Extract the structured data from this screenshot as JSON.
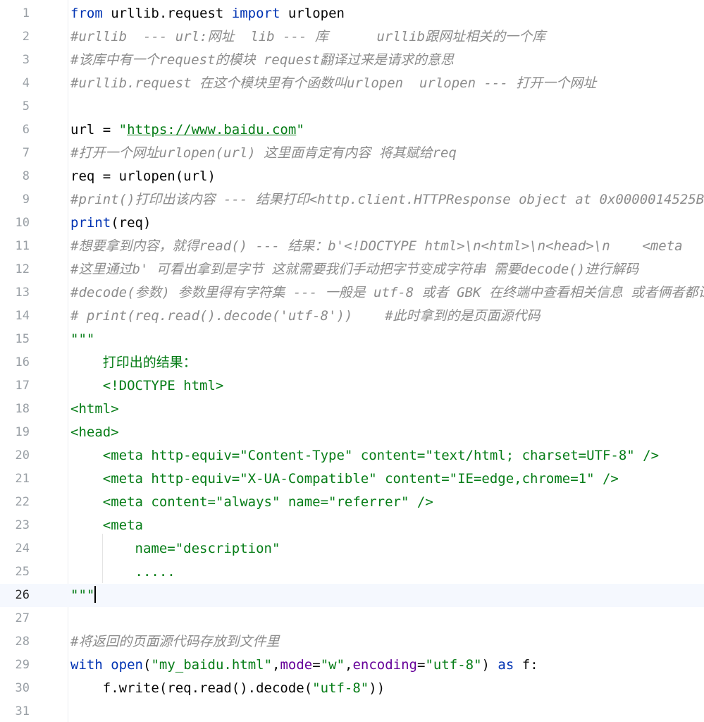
{
  "editor": {
    "line_numbers": [
      "1",
      "2",
      "3",
      "4",
      "5",
      "6",
      "7",
      "8",
      "9",
      "10",
      "11",
      "12",
      "13",
      "14",
      "15",
      "16",
      "17",
      "18",
      "19",
      "20",
      "21",
      "22",
      "23",
      "24",
      "25",
      "26",
      "27",
      "28",
      "29",
      "30",
      "31"
    ],
    "current_line": "26",
    "lines": {
      "l1": {
        "from": "from",
        "module": " urllib.request ",
        "import": "import",
        "name": " urlopen"
      },
      "l2": {
        "comment": "#urllib  --- url:网址  lib --- 库      urllib跟网址相关的一个库"
      },
      "l3": {
        "comment": "#该库中有一个request的模块 request翻译过来是请求的意思"
      },
      "l4": {
        "comment": "#urllib.request 在这个模块里有个函数叫urlopen  urlopen --- 打开一个网址"
      },
      "l6": {
        "lhs": "url = ",
        "q1": "\"",
        "url": "https://www.baidu.com",
        "q2": "\""
      },
      "l7": {
        "comment": "#打开一个网址urlopen(url) 这里面肯定有内容 将其赋给req"
      },
      "l8": {
        "code": "req = urlopen(url)"
      },
      "l9": {
        "comment": "#print()打印出该内容 --- 结果打印<http.client.HTTPResponse object at 0x0000014525B"
      },
      "l10": {
        "fn": "print",
        "rest": "(req)"
      },
      "l11": {
        "comment": "#想要拿到内容，就得read() --- 结果：b'<!DOCTYPE html>\\n<html>\\n<head>\\n    <meta"
      },
      "l12": {
        "comment": "#这里通过b' 可看出拿到是字节 这就需要我们手动把字节变成字符串 需要decode()进行解码"
      },
      "l13": {
        "comment": "#decode(参数) 参数里得有字符集 --- 一般是 utf-8 或者 GBK 在终端中查看相关信息 或者俩者都试"
      },
      "l14": {
        "comment": "# print(req.read().decode('utf-8'))    #此时拿到的是页面源代码"
      },
      "l15": {
        "str": "\"\"\""
      },
      "l16": {
        "str": "    打印出的结果："
      },
      "l17": {
        "str": "    <!DOCTYPE html>"
      },
      "l18": {
        "str": "<html>"
      },
      "l19": {
        "str": "<head>"
      },
      "l20": {
        "str": "    <meta http-equiv=\"Content-Type\" content=\"text/html; charset=UTF-8\" />"
      },
      "l21": {
        "str": "    <meta http-equiv=\"X-UA-Compatible\" content=\"IE=edge,chrome=1\" />"
      },
      "l22": {
        "str": "    <meta content=\"always\" name=\"referrer\" />"
      },
      "l23": {
        "str": "    <meta"
      },
      "l24": {
        "str": "        name=\"description\""
      },
      "l25": {
        "str": "        ....."
      },
      "l26": {
        "str": "\"\"\""
      },
      "l28": {
        "comment": "#将返回的页面源代码存放到文件里"
      },
      "l29": {
        "with": "with",
        "sp": " ",
        "open": "open",
        "p1": "(",
        "s1": "\"my_baidu.html\"",
        "c1": ",",
        "mode": "mode",
        "eq1": "=",
        "s2": "\"w\"",
        "c2": ",",
        "enc": "encoding",
        "eq2": "=",
        "s3": "\"utf-8\"",
        "p2": ") ",
        "as": "as",
        "f": " f:"
      },
      "l30": {
        "pre": "    f.write(req.read().decode(",
        "s": "\"utf-8\"",
        "post": "))"
      }
    }
  },
  "colors": {
    "keyword": "#0033b3",
    "string": "#067d17",
    "comment": "#8c8c8c",
    "named_param": "#660099",
    "current_line_bg": "#f5f8fe"
  }
}
